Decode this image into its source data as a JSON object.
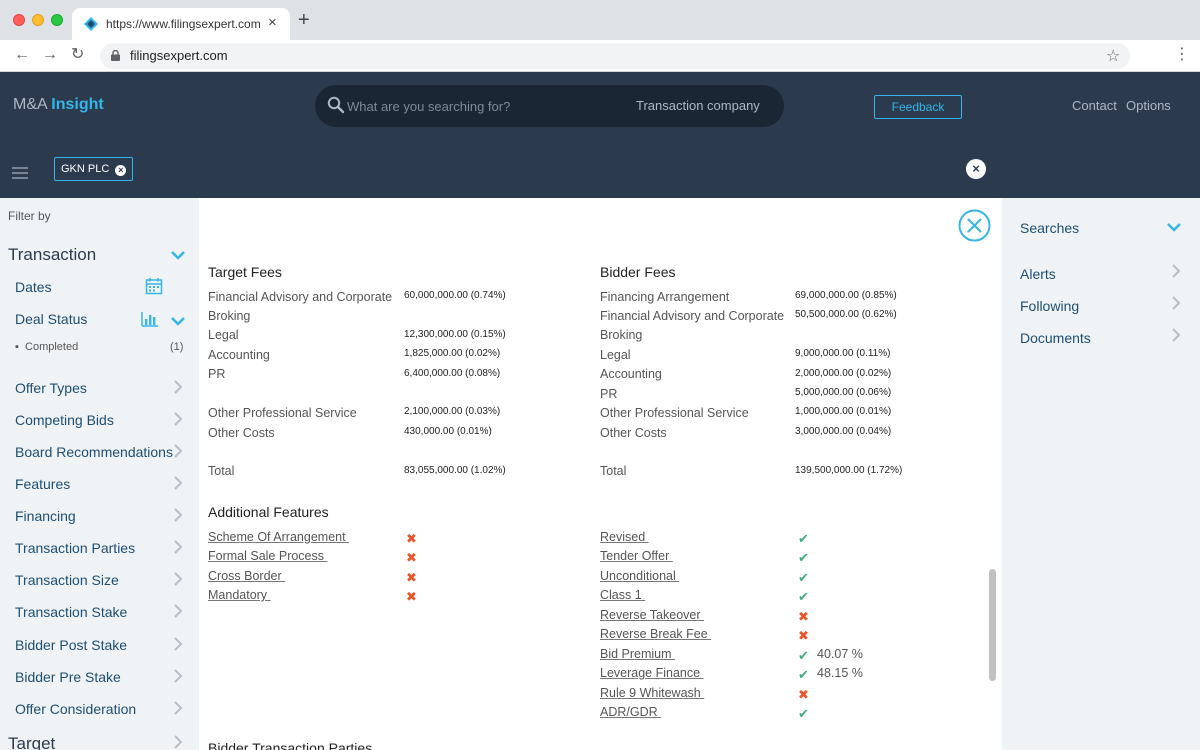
{
  "browser": {
    "tab_title": "https://www.filingsexpert.com/",
    "tab_close": "×",
    "new_tab": "+",
    "url": "filingsexpert.com",
    "back": "←",
    "forward": "→",
    "reload": "↻",
    "star": "☆",
    "menu": "⋮"
  },
  "header": {
    "logo_prefix": "M&A",
    "logo_accent": "Insight",
    "search_placeholder": "What are you searching for?",
    "search_scope": "Transaction company",
    "feedback_label": "Feedback",
    "contact_label": "Contact",
    "options_label": "Options",
    "chip_label": "GKN PLC",
    "chip_remove": "×",
    "clear_all": "×"
  },
  "sidebar": {
    "filter_by": "Filter by",
    "transaction_title": "Transaction",
    "dates": "Dates",
    "deal_status": "Deal Status",
    "completed": "Completed",
    "completed_count": "(1)",
    "items": [
      "Offer Types",
      "Competing Bids",
      "Board Recommendations",
      "Features",
      "Financing",
      "Transaction Parties",
      "Transaction Size",
      "Transaction Stake",
      "Bidder Post Stake",
      "Bidder Pre Stake",
      "Offer Consideration"
    ],
    "target_title": "Target"
  },
  "target_fees": {
    "title": "Target Fees",
    "rows": [
      {
        "label": "Financial Advisory and Corporate",
        "value": "60,000,000.00 (0.74%)"
      },
      {
        "label": "Broking",
        "value": ""
      },
      {
        "label": "Legal",
        "value": "12,300,000.00 (0.15%)"
      },
      {
        "label": "Accounting",
        "value": "1,825,000.00 (0.02%)"
      },
      {
        "label": "PR",
        "value": "6,400,000.00 (0.08%)"
      },
      {
        "label": "Other Professional Service",
        "value": "2,100,000.00 (0.03%)"
      },
      {
        "label": "Other Costs",
        "value": "430,000.00 (0.01%)"
      },
      {
        "label": "Total",
        "value": "83,055,000.00 (1.02%)"
      }
    ]
  },
  "bidder_fees": {
    "title": "Bidder Fees",
    "rows": [
      {
        "label": "Financing Arrangement",
        "value": "69,000,000.00 (0.85%)"
      },
      {
        "label": "Financial Advisory and Corporate",
        "value": "50,500,000.00 (0.62%)"
      },
      {
        "label": "Broking",
        "value": ""
      },
      {
        "label": "Legal",
        "value": "9,000,000.00 (0.11%)"
      },
      {
        "label": "Accounting",
        "value": "2,000,000.00 (0.02%)"
      },
      {
        "label": "PR",
        "value": "5,000,000.00 (0.06%)"
      },
      {
        "label": "Other Professional Service",
        "value": "1,000,000.00 (0.01%)"
      },
      {
        "label": "Other Costs",
        "value": "3,000,000.00 (0.04%)"
      },
      {
        "label": "Total",
        "value": "139,500,000.00 (1.72%)"
      }
    ]
  },
  "additional_features": {
    "title": "Additional Features",
    "left": [
      {
        "label": "Scheme Of Arrangement ",
        "mark": "✖"
      },
      {
        "label": "Formal Sale Process ",
        "mark": "✖"
      },
      {
        "label": "Cross Border ",
        "mark": "✖"
      },
      {
        "label": "Mandatory ",
        "mark": "✖"
      }
    ],
    "right": [
      {
        "label": "Revised ",
        "mark": "✔",
        "extra": ""
      },
      {
        "label": "Tender Offer ",
        "mark": "✔",
        "extra": ""
      },
      {
        "label": "Unconditional ",
        "mark": "✔",
        "extra": ""
      },
      {
        "label": "Class 1 ",
        "mark": "✔",
        "extra": ""
      },
      {
        "label": "Reverse Takeover ",
        "mark": "✖",
        "extra": ""
      },
      {
        "label": "Reverse Break Fee ",
        "mark": "✖",
        "extra": ""
      },
      {
        "label": "Bid Premium ",
        "mark": "✔",
        "extra": "40.07 %"
      },
      {
        "label": "Leverage Finance ",
        "mark": "✔",
        "extra": "48.15 %"
      },
      {
        "label": "Rule 9 Whitewash ",
        "mark": "✖",
        "extra": ""
      },
      {
        "label": "ADR/GDR ",
        "mark": "✔",
        "extra": ""
      }
    ],
    "next_section_partial": "Bidder Transaction Parties"
  },
  "right_sidebar": {
    "searches": "Searches",
    "alerts": "Alerts",
    "following": "Following",
    "documents": "Documents"
  },
  "colors": {
    "header_bg": "#2b3a4d",
    "accent": "#35b5e9",
    "yes": "#3fae7c",
    "no": "#e8562a",
    "sidebar_bg": "#f0f3f6"
  }
}
